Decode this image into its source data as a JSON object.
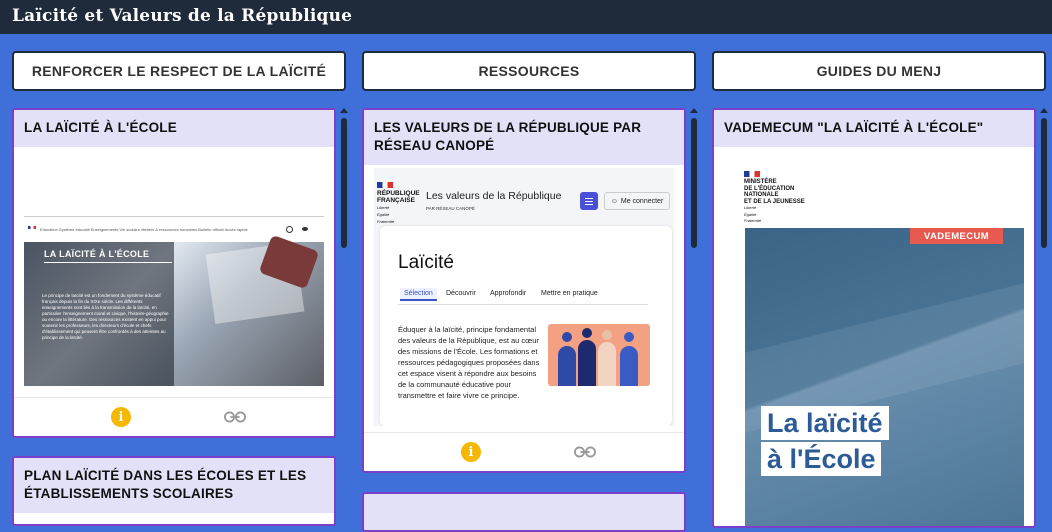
{
  "app": {
    "title": "Laïcité et Valeurs de la République"
  },
  "columns": [
    {
      "label": "RENFORCER LE RESPECT DE LA LAÏCITÉ"
    },
    {
      "label": "RESSOURCES"
    },
    {
      "label": "GUIDES DU MENJ"
    }
  ],
  "cards": {
    "c1": {
      "title": "LA LAÏCITÉ À L'ÉCOLE",
      "thumb": {
        "nav": "Education   Système éducatif   Enseignements   Vie scolaire   Métiers & ressources humaines   Bulletin officiel   Accès rapide",
        "heading": "LA LAÏCITÉ À L'ÉCOLE",
        "text": "Le principe de laïcité est un fondement du système éducatif français depuis la fin du XIXe siècle. Les différents enseignements sont liés à la transmission de la laïcité, en particulier l'enseignement moral et civique, l'histoire-géographie ou encore la littérature. Des ressources existent en appui pour soutenir les professeurs, les directeurs d'école et chefs d'établissement qui peuvent être confrontés à des atteintes au principe de la laïcité."
      }
    },
    "c2": {
      "title": "PLAN LAÏCITÉ DANS LES ÉCOLES ET LES ÉTABLISSEMENTS SCOLAIRES"
    },
    "c3": {
      "title": "LES VALEURS DE LA RÉPUBLIQUE PAR RÉSEAU CANOPÉ",
      "thumb": {
        "rf": "RÉPUBLIQUE\nFRANÇAISE",
        "motto": "Liberté\nÉgalité\nFraternité",
        "site_name": "Les valeurs de la République",
        "site_sub": "PAR RÉSEAU CANOPÉ",
        "login": "Me connecter",
        "heading": "Laïcité",
        "tabs": [
          "Sélection",
          "Découvrir",
          "Approfondir",
          "Mettre en pratique"
        ],
        "body": "Éduquer à la laïcité, principe fondamental des valeurs de la République, est au cœur des missions de l'École. Les formations et ressources pédagogiques proposées dans cet espace visent à répondre aux besoins de la communauté éducative pour transmettre et faire vivre ce principe."
      }
    },
    "c5": {
      "title": "VADEMECUM \"LA LAÏCITÉ À L'ÉCOLE\"",
      "thumb": {
        "ministry": "MINISTÈRE\nDE L'ÉDUCATION\nNATIONALE\nET DE LA JEUNESSE",
        "motto": "Liberté\nÉgalité\nFraternité",
        "band": "VADEMECUM",
        "cover_title_1": "La laïcité",
        "cover_title_2": "à l'École"
      }
    }
  },
  "icons": {
    "info": "info-icon",
    "link": "link-icon"
  },
  "colors": {
    "accent_info": "#f5b800",
    "card_border": "#7b3fc8",
    "background": "#3f6fd9",
    "header": "#1f2a3a"
  }
}
